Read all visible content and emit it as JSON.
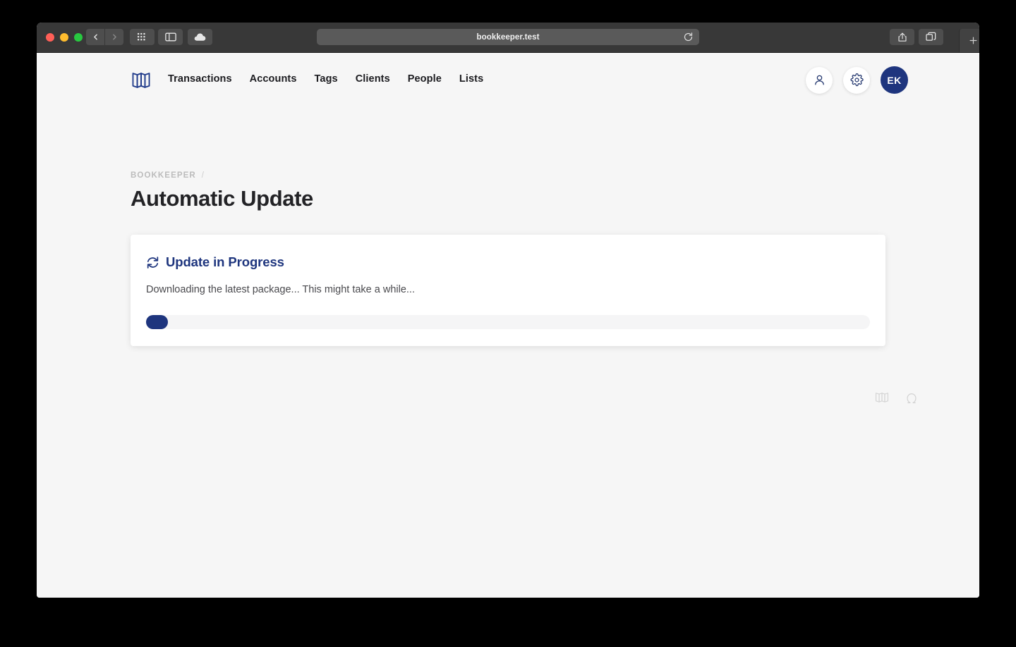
{
  "browser": {
    "url": "bookkeeper.test",
    "back_label": "Back",
    "forward_label": "Forward",
    "grid_label": "Show tab overview grid",
    "sidebar_label": "Show sidebar",
    "cloud_label": "iCloud tabs",
    "reload_label": "Reload page",
    "share_label": "Share",
    "tabs_label": "Tab overview",
    "new_tab_label": "+"
  },
  "app": {
    "logo_name": "Bookkeeper",
    "nav": [
      {
        "label": "Transactions"
      },
      {
        "label": "Accounts"
      },
      {
        "label": "Tags"
      },
      {
        "label": "Clients"
      },
      {
        "label": "People"
      },
      {
        "label": "Lists"
      }
    ],
    "actions": {
      "profile_label": "Profile",
      "settings_label": "Settings",
      "avatar_initials": "EK"
    }
  },
  "breadcrumb": {
    "root": "BOOKKEEPER",
    "separator": "/"
  },
  "page": {
    "title": "Automatic Update"
  },
  "card": {
    "title": "Update in Progress",
    "description": "Downloading the latest package... This might take a while...",
    "progress_percent": 3
  },
  "footer": {
    "logo_label": "Bookkeeper mark",
    "omega_label": "Omega"
  },
  "colors": {
    "brand_navy": "#1e357e",
    "page_background": "#f6f6f6",
    "card_background": "#ffffff",
    "progress_track": "#f5f5f6",
    "title_text": "#232326",
    "breadcrumb_text": "#bcbcbc"
  }
}
